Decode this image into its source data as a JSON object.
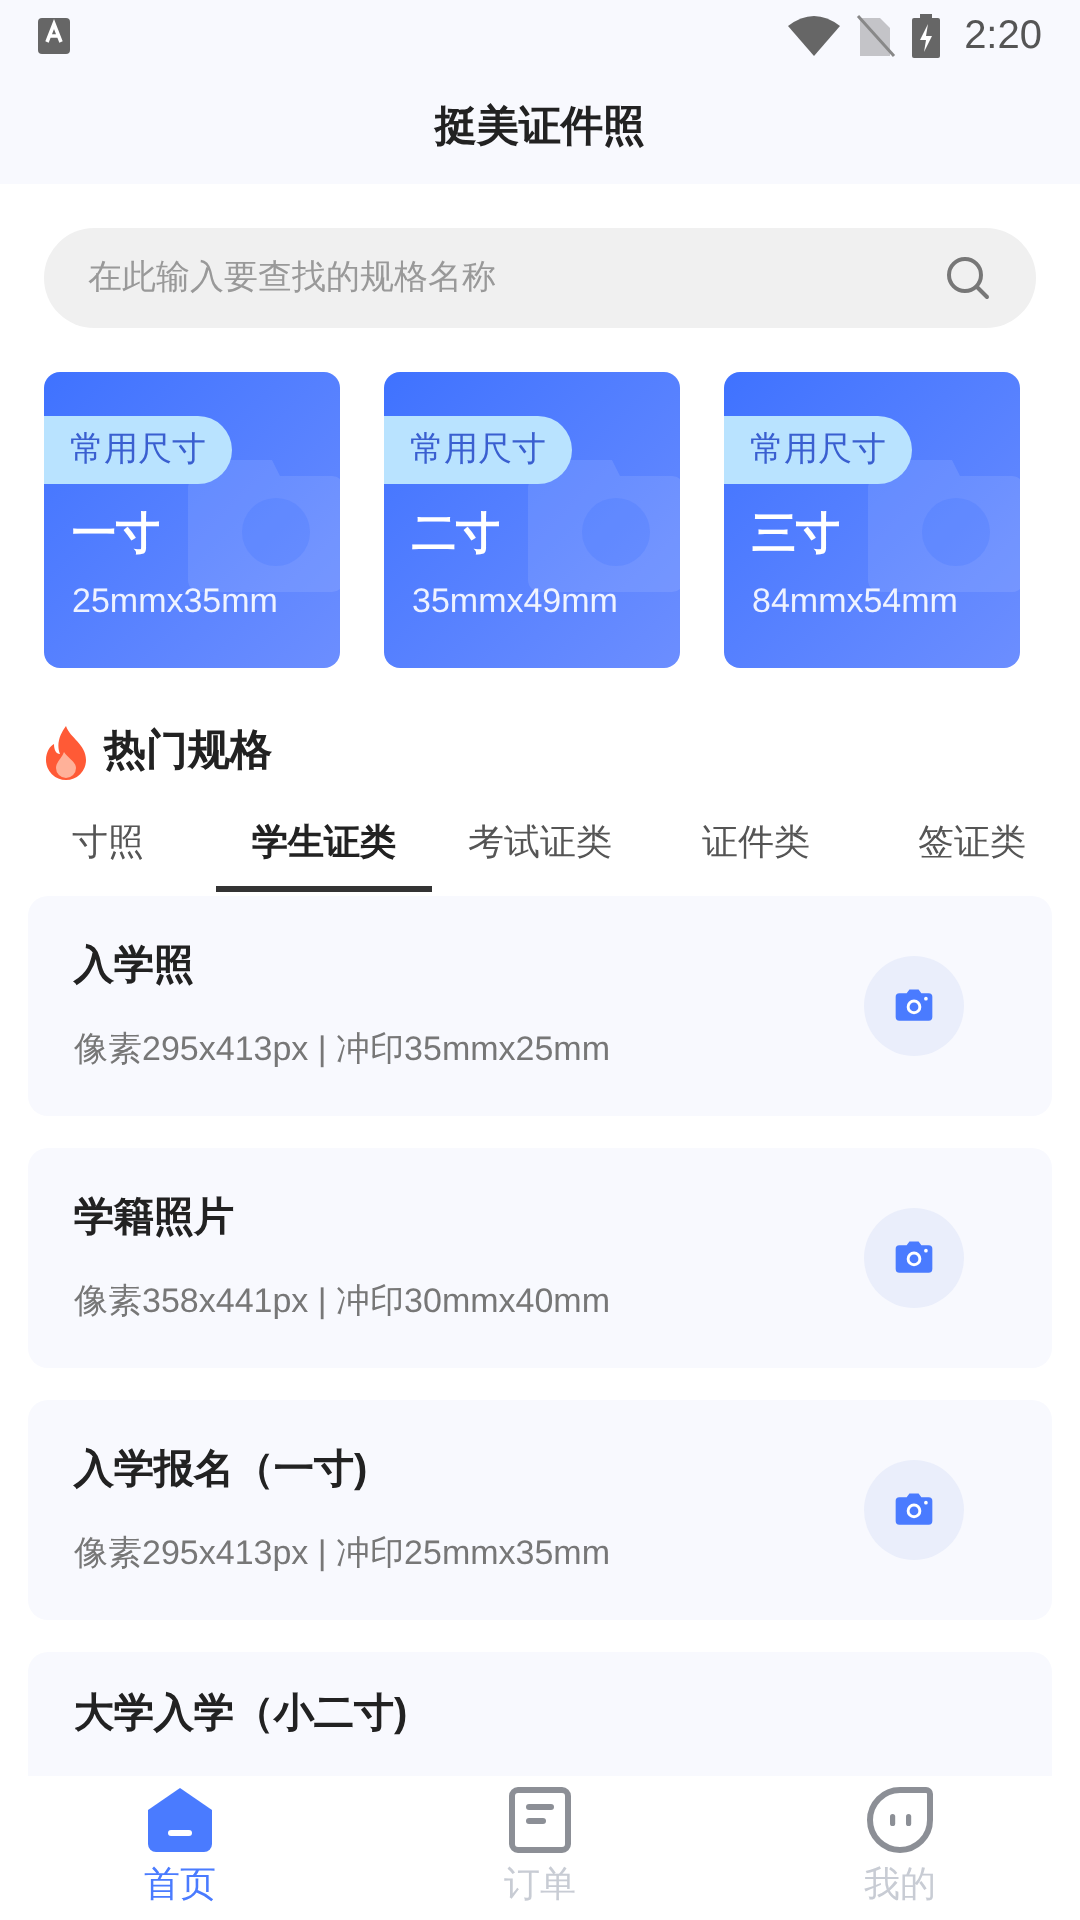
{
  "status_bar": {
    "time": "2:20"
  },
  "header": {
    "title": "挺美证件照"
  },
  "search": {
    "placeholder": "在此输入要查找的规格名称"
  },
  "size_cards": [
    {
      "tag": "常用尺寸",
      "name": "一寸",
      "size": "25mmx35mm"
    },
    {
      "tag": "常用尺寸",
      "name": "二寸",
      "size": "35mmx49mm"
    },
    {
      "tag": "常用尺寸",
      "name": "三寸",
      "size": "84mmx54mm"
    }
  ],
  "hot_section": {
    "title": "热门规格"
  },
  "tabs": [
    {
      "label": "寸照",
      "selected": false
    },
    {
      "label": "学生证类",
      "selected": true
    },
    {
      "label": "考试证类",
      "selected": false
    },
    {
      "label": "证件类",
      "selected": false
    },
    {
      "label": "签证类",
      "selected": false
    }
  ],
  "specs": [
    {
      "name": "入学照",
      "detail": "像素295x413px | 冲印35mmx25mm"
    },
    {
      "name": "学籍照片",
      "detail": "像素358x441px | 冲印30mmx40mm"
    },
    {
      "name": "入学报名（一寸)",
      "detail": "像素295x413px | 冲印25mmx35mm"
    },
    {
      "name": "大学入学（小二寸)"
    }
  ],
  "bottom_nav": [
    {
      "label": "首页",
      "selected": true
    },
    {
      "label": "订单",
      "selected": false
    },
    {
      "label": "我的",
      "selected": false
    }
  ]
}
